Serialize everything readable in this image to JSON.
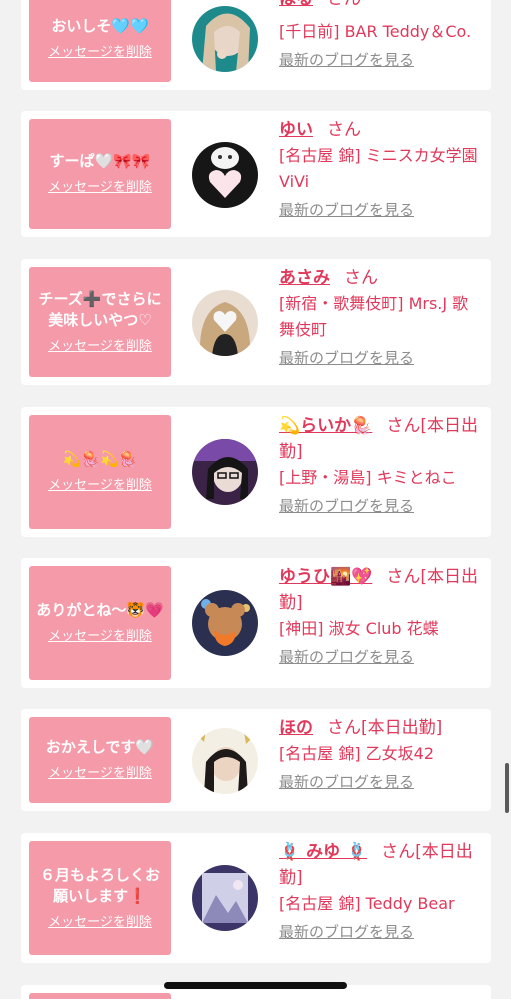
{
  "messages": [
    {
      "text": "おいしそ🩵🩵",
      "delete_label": "メッセージを削除",
      "name": "はる",
      "honorific": "さん",
      "shop": "[千日前] BAR Teddy＆Co.",
      "blog_label": "最新のブログを見る",
      "avatar_icon": "avatar-photo-icon"
    },
    {
      "text": "すーぱ🤍🎀🎀",
      "delete_label": "メッセージを削除",
      "name": "ゆい",
      "honorific": "さん",
      "shop": "[名古屋 錦] ミニスカ女学園ViVi",
      "blog_label": "最新のブログを見る",
      "avatar_icon": "avatar-photo-icon"
    },
    {
      "text": "チーズ➕でさらに美味しいやつ♡",
      "delete_label": "メッセージを削除",
      "name": "あさみ",
      "honorific": "さん",
      "shop": "[新宿・歌舞伎町] Mrs.J 歌舞伎町",
      "blog_label": "最新のブログを見る",
      "avatar_icon": "avatar-photo-icon"
    },
    {
      "text": "💫🪼💫🪼",
      "delete_label": "メッセージを削除",
      "name": "💫らいか🪼",
      "honorific": "さん[本日出勤]",
      "shop": "[上野・湯島] キミとねこ",
      "blog_label": "最新のブログを見る",
      "avatar_icon": "avatar-photo-icon"
    },
    {
      "text": "ありがとね〜🐯💗",
      "delete_label": "メッセージを削除",
      "name": "ゆうひ🌇💖",
      "honorific": "さん[本日出勤]",
      "shop": "[神田] 淑女 Club 花蝶",
      "blog_label": "最新のブログを見る",
      "avatar_icon": "avatar-photo-icon"
    },
    {
      "text": "おかえしです🤍",
      "delete_label": "メッセージを削除",
      "name": "ほの",
      "honorific": "さん[本日出勤]",
      "shop": "[名古屋 錦] 乙女坂42",
      "blog_label": "最新のブログを見る",
      "avatar_icon": "avatar-photo-icon"
    },
    {
      "text": "６月もよろしくお願いします❗",
      "delete_label": "メッセージを削除",
      "name": "🪢 みゆ 🪢",
      "honorific": "さん[本日出勤]",
      "shop": "[名古屋 錦] Teddy Bear",
      "blog_label": "最新のブログを見る",
      "avatar_icon": "avatar-photo-icon"
    }
  ],
  "colors": {
    "accent": "#e0395b",
    "bubble": "#f49aa9",
    "muted_link": "#8c8c8c",
    "background": "#f2f2f2"
  }
}
